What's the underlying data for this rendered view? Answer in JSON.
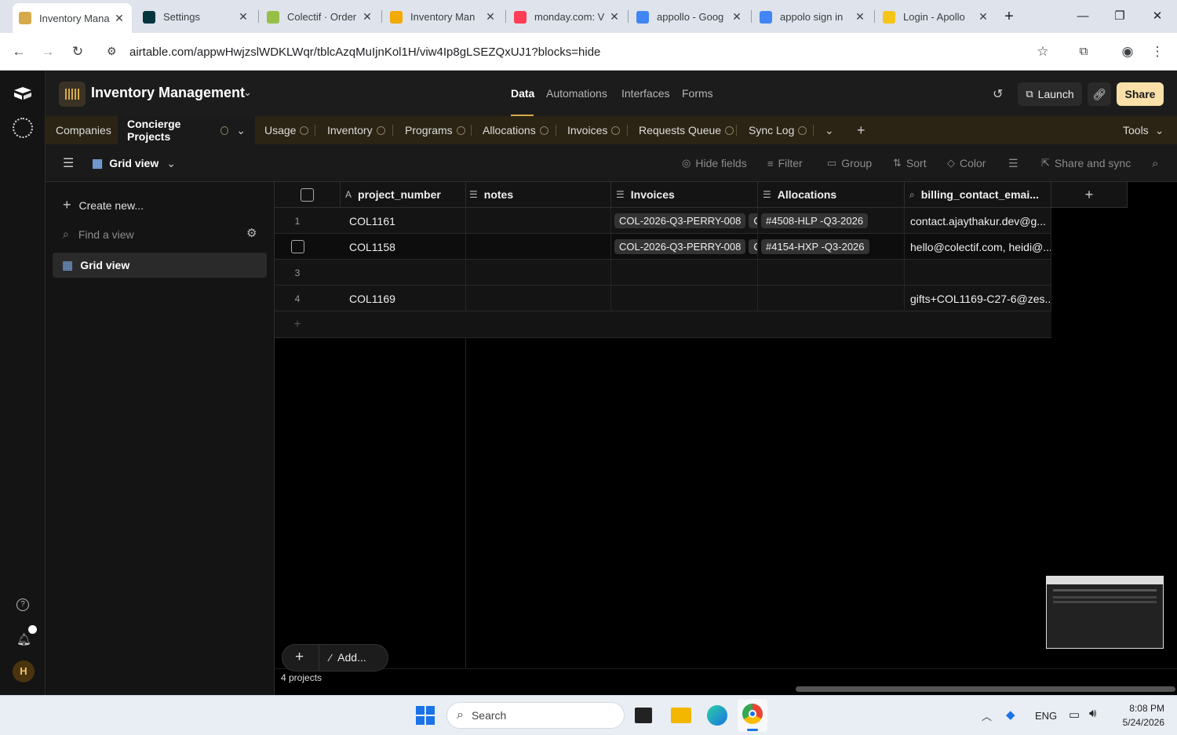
{
  "browser": {
    "tabs": [
      {
        "label": "Inventory Mana",
        "icon": "airtable-icon",
        "color": "#d6a94a",
        "active": true
      },
      {
        "label": "Settings",
        "icon": "zendesk-icon",
        "color": "#03363d"
      },
      {
        "label": "Colectif · Order",
        "icon": "shopify-icon",
        "color": "#95bf47"
      },
      {
        "label": "Inventory Man",
        "icon": "airtable-icon",
        "color": "#f2a900"
      },
      {
        "label": "monday.com: V",
        "icon": "monday-icon",
        "color": "#ff3d57"
      },
      {
        "label": "appollo - Goog",
        "icon": "google-icon",
        "color": "#4285f4"
      },
      {
        "label": "appolo sign in",
        "icon": "google-icon",
        "color": "#4285f4"
      },
      {
        "label": "Login - Apollo",
        "icon": "apollo-icon",
        "color": "#f5c518"
      }
    ],
    "url": "airtable.com/appwHwjzslWDKLWqr/tblcAzqMuIjnKol1H/viw4Ip8gLSEZQxUJ1?blocks=hide"
  },
  "header": {
    "base_name": "Inventory Management",
    "tabs": [
      "Data",
      "Automations",
      "Interfaces",
      "Forms"
    ],
    "launch_label": "Launch",
    "share_label": "Share"
  },
  "tables": {
    "items": [
      "Companies",
      "Concierge Projects",
      "Usage",
      "Inventory",
      "Programs",
      "Allocations",
      "Invoices",
      "Requests Queue",
      "Sync Log"
    ],
    "tools_label": "Tools"
  },
  "viewbar": {
    "view_name": "Grid view",
    "hide_fields": "Hide fields",
    "filter": "Filter",
    "group": "Group",
    "sort": "Sort",
    "color": "Color",
    "share_sync": "Share and sync"
  },
  "sidebar": {
    "create_new": "Create new...",
    "find_placeholder": "Find a view",
    "view_item": "Grid view",
    "avatar_initial": "H"
  },
  "grid": {
    "columns": [
      "project_number",
      "notes",
      "Invoices",
      "Allocations",
      "billing_contact_emai..."
    ],
    "rows": [
      {
        "num": "1",
        "project_number": "COL1161",
        "notes": "",
        "invoices": [
          "COL-2026-Q3-PERRY-008",
          "C"
        ],
        "allocations": [
          "#4508-HLP -Q3-2026"
        ],
        "billing": "contact.ajaythakur.dev@g..."
      },
      {
        "num": "",
        "project_number": "COL1158",
        "notes": "",
        "invoices": [
          "COL-2026-Q3-PERRY-008",
          "C"
        ],
        "allocations": [
          "#4154-HXP -Q3-2026"
        ],
        "billing": "hello@colectif.com, heidi@..."
      },
      {
        "num": "3",
        "project_number": "",
        "notes": "",
        "invoices": [],
        "allocations": [],
        "billing": ""
      },
      {
        "num": "4",
        "project_number": "COL1169",
        "notes": "",
        "invoices": [],
        "allocations": [],
        "billing": "gifts+COL1169-C27-6@zes..."
      }
    ],
    "add_label": "Add...",
    "record_count": "4 projects"
  },
  "taskbar": {
    "search_placeholder": "Search",
    "lang": "ENG",
    "time": "8:08 PM",
    "date": "5/24/2026"
  }
}
